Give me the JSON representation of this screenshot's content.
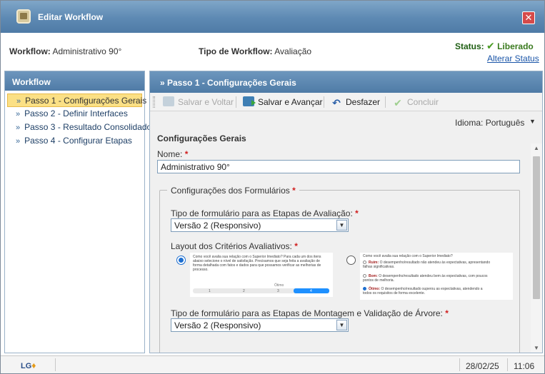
{
  "window": {
    "title": "Editar Workflow",
    "close_label": "✕"
  },
  "info": {
    "workflow_label": "Workflow:",
    "workflow_value": "Administrativo 90°",
    "tipo_label": "Tipo de Workflow:",
    "tipo_value": "Avaliação",
    "status_label": "Status:",
    "status_value": "Liberado",
    "alterar_status": "Alterar Status"
  },
  "sidebar": {
    "title": "Workflow",
    "items": [
      {
        "label": "Passo 1 - Configurações Gerais",
        "active": true
      },
      {
        "label": "Passo 2 - Definir Interfaces",
        "active": false
      },
      {
        "label": "Passo 3 - Resultado Consolidado",
        "active": false
      },
      {
        "label": "Passo 4 - Configurar Etapas",
        "active": false
      }
    ]
  },
  "main": {
    "title": "» Passo 1 - Configurações Gerais"
  },
  "toolbar": {
    "save_back": "Salvar e Voltar",
    "save_advance": "Salvar e Avançar",
    "undo": "Desfazer",
    "conclude": "Concluir"
  },
  "language": {
    "label": "Idioma:",
    "value": "Português"
  },
  "form": {
    "section_title": "Configurações Gerais",
    "name_label": "Nome:",
    "name_value": "Administrativo 90°",
    "forms_legend": "Configurações dos Formulários",
    "eval_type_label": "Tipo de formulário para as Etapas de Avaliação:",
    "eval_type_value": "Versão 2 (Responsivo)",
    "layout_label": "Layout dos Critérios Avaliativos:",
    "tree_type_label": "Tipo de formulário para as Etapas de Montagem e Validação de Árvore:",
    "tree_type_value": "Versão 2 (Responsivo)",
    "required_mark": "*"
  },
  "preview_a": {
    "question": "Como você avalia sua relação com o Superior Imediato? Para cada um dos itens abaixo selecione o nível de satisfação. Precisamos que seja feita a avaliação de forma detalhada com fatos e dados para que possamos verificar as melhorias de processo.",
    "scale_caption": "Ótimo",
    "scale": [
      "1",
      "2",
      "3",
      "4"
    ]
  },
  "preview_b": {
    "question": "Como você avalia sua relação com o Superior Imediato?",
    "options": [
      {
        "title": "Ruim:",
        "text": "O desempenho/resultado não atendeu às expectativas, apresentando falhas significativas."
      },
      {
        "title": "Bom:",
        "text": "O desempenho/resultado atendeu bem às expectativas, com poucos pontos de melhoria."
      },
      {
        "title": "Ótimo:",
        "text": "O desempenho/resultado superou as expectativas, atendendo a todos os requisitos de forma excelente."
      }
    ]
  },
  "footer": {
    "logo": "LG",
    "date": "28/02/25",
    "time": "11:06"
  }
}
